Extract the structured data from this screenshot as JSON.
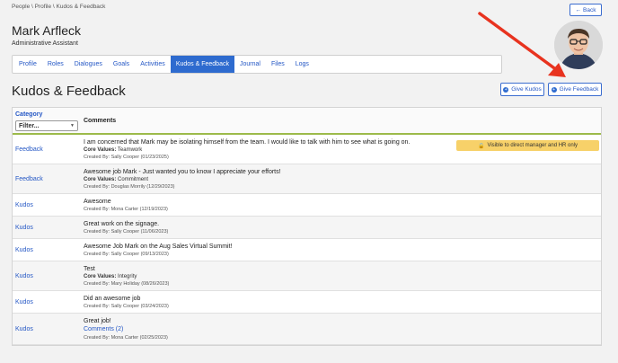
{
  "breadcrumb": "People \\ Profile \\ Kudos & Feedback",
  "person": {
    "name": "Mark Arfleck",
    "role": "Administrative Assistant"
  },
  "back_label": "Back",
  "tabs": [
    {
      "label": "Profile",
      "active": false
    },
    {
      "label": "Roles",
      "active": false
    },
    {
      "label": "Dialogues",
      "active": false
    },
    {
      "label": "Goals",
      "active": false
    },
    {
      "label": "Activities",
      "active": false
    },
    {
      "label": "Kudos & Feedback",
      "active": true
    },
    {
      "label": "Journal",
      "active": false
    },
    {
      "label": "Files",
      "active": false
    },
    {
      "label": "Logs",
      "active": false
    }
  ],
  "section_title": "Kudos & Feedback",
  "actions": {
    "give_kudos": "Give Kudos",
    "give_feedback": "Give Feedback"
  },
  "table": {
    "category_header": "Category",
    "filter_placeholder": "Filter...",
    "comments_header": "Comments",
    "rows": [
      {
        "category": "Feedback",
        "text": "I am concerned that Mark may be isolating himself from the team. I would like to talk with him to see what is going on.",
        "core_label": "Core Values:",
        "core_values": "Teamwork",
        "created_by": "Created By: Sally Cooper (01/23/2025)",
        "badge": "Visible to direct manager and HR only"
      },
      {
        "category": "Feedback",
        "text": "Awesome job Mark - Just wanted you to know I appreciate your efforts!",
        "core_label": "Core Values:",
        "core_values": "Commitment",
        "created_by": "Created By: Douglas Morrily (12/29/2023)"
      },
      {
        "category": "Kudos",
        "text": "Awesome",
        "created_by": "Created By: Mona Carter (12/19/2023)"
      },
      {
        "category": "Kudos",
        "text": "Great work on the signage.",
        "created_by": "Created By: Sally Cooper (11/06/2023)"
      },
      {
        "category": "Kudos",
        "text": "Awesome Job Mark on the Aug Sales Virtual Summit!",
        "created_by": "Created By: Sally Cooper (09/13/2023)"
      },
      {
        "category": "Kudos",
        "text": "Test",
        "core_label": "Core Values:",
        "core_values": "Integrity",
        "created_by": "Created By: Mary Holiday (08/26/2023)"
      },
      {
        "category": "Kudos",
        "text": "Did an awesome job",
        "created_by": "Created By: Sally Cooper (03/24/2023)"
      },
      {
        "category": "Kudos",
        "text": "Great job!",
        "comments_link": "Comments (2)",
        "created_by": "Created By: Mona Carter (02/25/2023)"
      }
    ]
  },
  "colors": {
    "accent": "#2e6bcf",
    "badge": "#f7d169",
    "arrow": "#e8331f",
    "header_rule": "#9cba4a"
  }
}
